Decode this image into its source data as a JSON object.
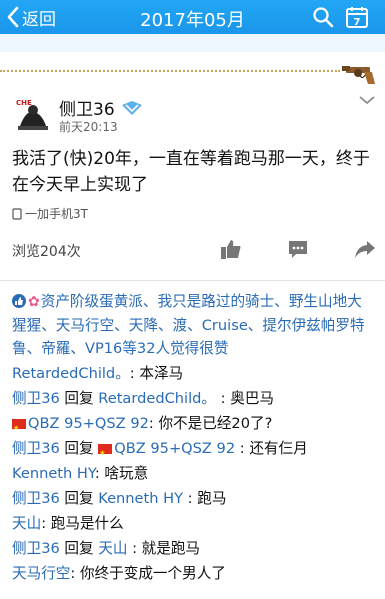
{
  "header": {
    "back_label": "返回",
    "title": "2017年05月",
    "calendar_day": "7"
  },
  "post": {
    "author": "侧卫36",
    "time": "前天20:13",
    "content": "我活了(快)20年，一直在等着跑马那一天，终于在今天早上实现了",
    "device": "一加手机3T",
    "views": "浏览204次"
  },
  "likes": {
    "names": "资产阶级蛋黄派、我只是路过的骑士、野生山地大猩猩、天马行空、天降、渡、Cruise、提尔伊兹帕罗特鲁、帝羅、VP16",
    "suffix": "等32人觉得很赞"
  },
  "comments": [
    {
      "name": "RetardedChild。",
      "text": ": 本泽马"
    },
    {
      "name": "侧卫36",
      "reply": " 回复 ",
      "to": "RetardedChild。",
      "text": " : 奥巴马"
    },
    {
      "name": "QBZ 95+QSZ 92",
      "flag": true,
      "text": ": 你不是已经20了?"
    },
    {
      "name": "侧卫36",
      "reply": " 回复 ",
      "to": "QBZ 95+QSZ 92",
      "toFlag": true,
      "text": " : 还有仨月"
    },
    {
      "name": "Kenneth HY",
      "text": ": 啥玩意"
    },
    {
      "name": "侧卫36",
      "reply": " 回复 ",
      "to": "Kenneth HY",
      "text": " : 跑马"
    },
    {
      "name": "天山",
      "text": ": 跑马是什么"
    },
    {
      "name": "侧卫36",
      "reply": " 回复 ",
      "to": "天山",
      "text": " : 就是跑马"
    },
    {
      "name": "天马行空",
      "text": ": 你终于变成一个男人了"
    }
  ],
  "colors": {
    "header": "#1d9bf0",
    "link": "#2a6bb6"
  },
  "icons": [
    "back-chevron-icon",
    "search-icon",
    "calendar-icon",
    "revolver-icon",
    "avatar",
    "verified-badge-icon",
    "chevron-down-icon",
    "phone-icon",
    "like-icon",
    "comment-icon",
    "share-icon",
    "thumb-icon",
    "flower-icon",
    "flag-icon"
  ]
}
